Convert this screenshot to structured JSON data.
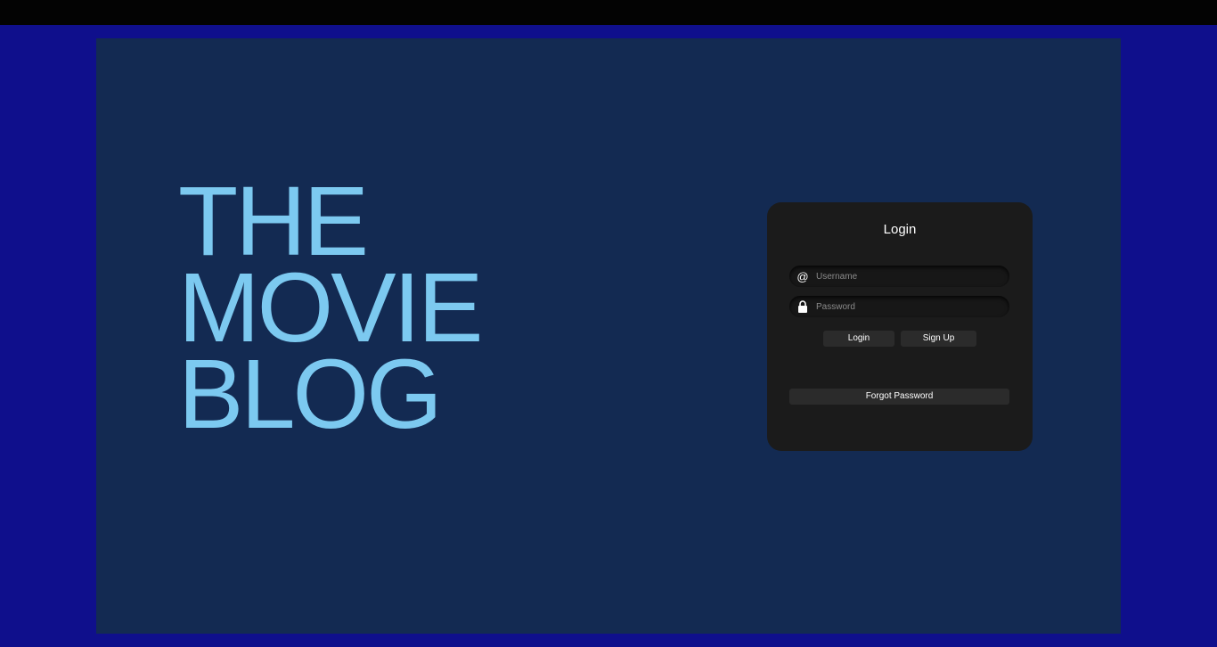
{
  "hero": {
    "line1": "THE",
    "line2": "MOVIE",
    "line3": "BLOG"
  },
  "login": {
    "title": "Login",
    "username_placeholder": "Username",
    "password_placeholder": "Password",
    "username_icon": "@",
    "login_button": "Login",
    "signup_button": "Sign Up",
    "forgot_button": "Forgot Password"
  },
  "icons": {
    "username": "at-icon",
    "password": "lock-icon"
  },
  "colors": {
    "page_bg": "#0f0f8c",
    "panel_bg": "#132a52",
    "hero_text": "#7cc9f0",
    "card_bg": "#1b1b1b",
    "button_bg": "#2b2b2b"
  }
}
